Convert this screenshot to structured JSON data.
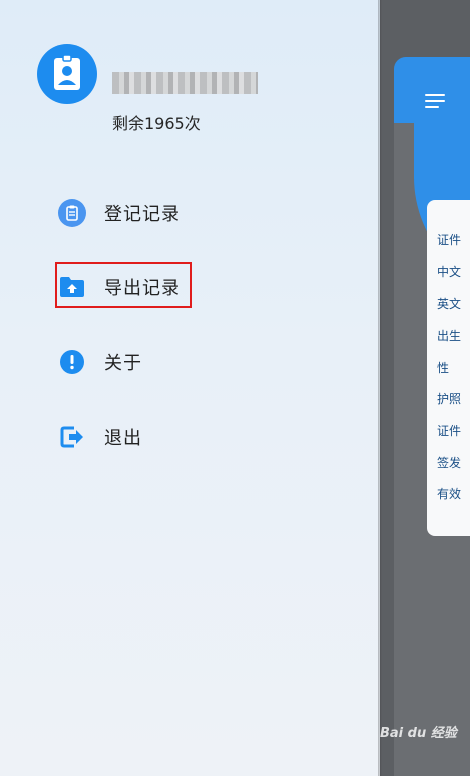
{
  "drawer": {
    "quota_text": "剩余1965次",
    "items": [
      {
        "label": "登记记录",
        "icon": "clipboard-icon"
      },
      {
        "label": "导出记录",
        "icon": "folder-upload-icon"
      },
      {
        "label": "关于",
        "icon": "info-exclamation-icon"
      },
      {
        "label": "退出",
        "icon": "logout-icon"
      }
    ]
  },
  "app": {
    "fields": [
      "证件",
      "中文",
      "英文",
      "出生",
      "性",
      "护照",
      "证件",
      "签发",
      "有效"
    ]
  },
  "watermark": "Bai du 经验",
  "colors": {
    "accent": "#1d8cef",
    "highlight_border": "#e01c1c",
    "header": "#2f8fe8"
  }
}
